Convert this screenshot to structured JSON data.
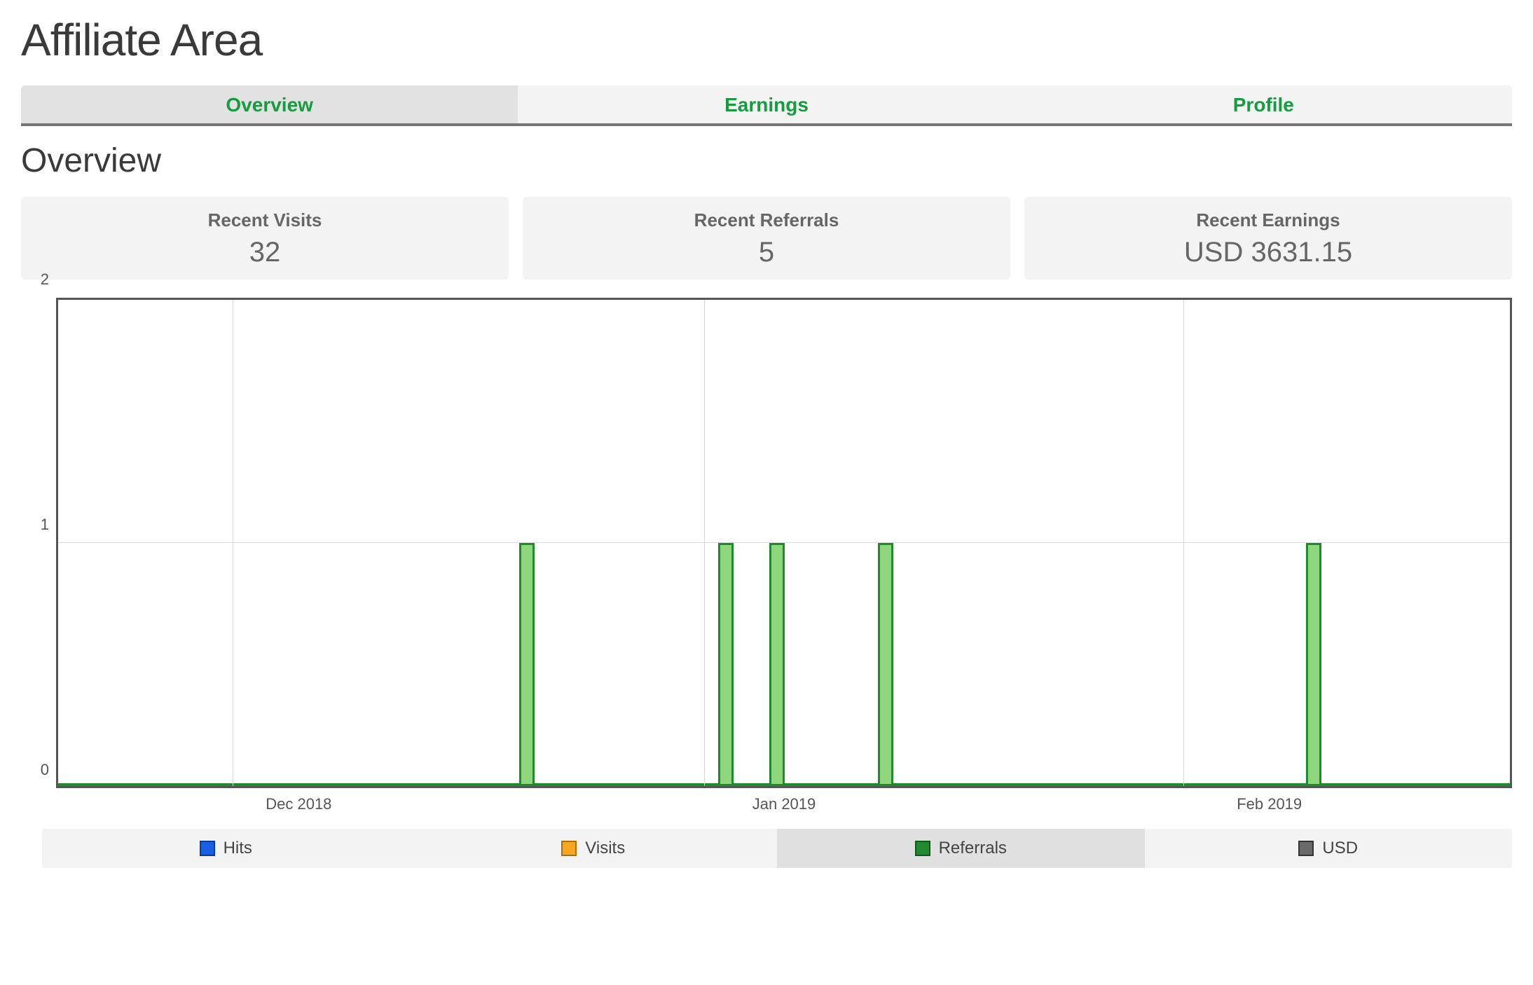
{
  "page": {
    "title": "Affiliate Area",
    "section": "Overview"
  },
  "tabs": [
    {
      "label": "Overview",
      "active": true
    },
    {
      "label": "Earnings",
      "active": false
    },
    {
      "label": "Profile",
      "active": false
    }
  ],
  "stats": {
    "visits": {
      "label": "Recent Visits",
      "value": "32"
    },
    "referrals": {
      "label": "Recent Referrals",
      "value": "5"
    },
    "earnings": {
      "label": "Recent Earnings",
      "value": "USD 3631.15"
    }
  },
  "legend": {
    "hits": "Hits",
    "visits": "Visits",
    "ref": "Referrals",
    "usd": "USD",
    "selected": "ref"
  },
  "chart_data": {
    "type": "bar",
    "title": "",
    "xlabel": "",
    "ylabel": "",
    "ylim": [
      0,
      2
    ],
    "yticks": [
      0,
      1,
      2
    ],
    "x_tick_labels": [
      "Dec 2018",
      "Jan 2019",
      "Feb 2019"
    ],
    "x_tick_positions_pct": [
      12,
      44.5,
      77.5
    ],
    "series": [
      {
        "name": "Hits",
        "color": "#1a5ee6",
        "x_pct": [],
        "values": []
      },
      {
        "name": "Visits",
        "color": "#f5a623",
        "x_pct": [],
        "values": []
      },
      {
        "name": "Referrals",
        "color": "#1f8a2f",
        "x_pct": [
          32.3,
          46.0,
          49.5,
          57.0,
          86.5
        ],
        "values": [
          1,
          1,
          1,
          1,
          1
        ]
      },
      {
        "name": "USD",
        "color": "#6a6a6a",
        "x_pct": [],
        "values": []
      }
    ]
  }
}
